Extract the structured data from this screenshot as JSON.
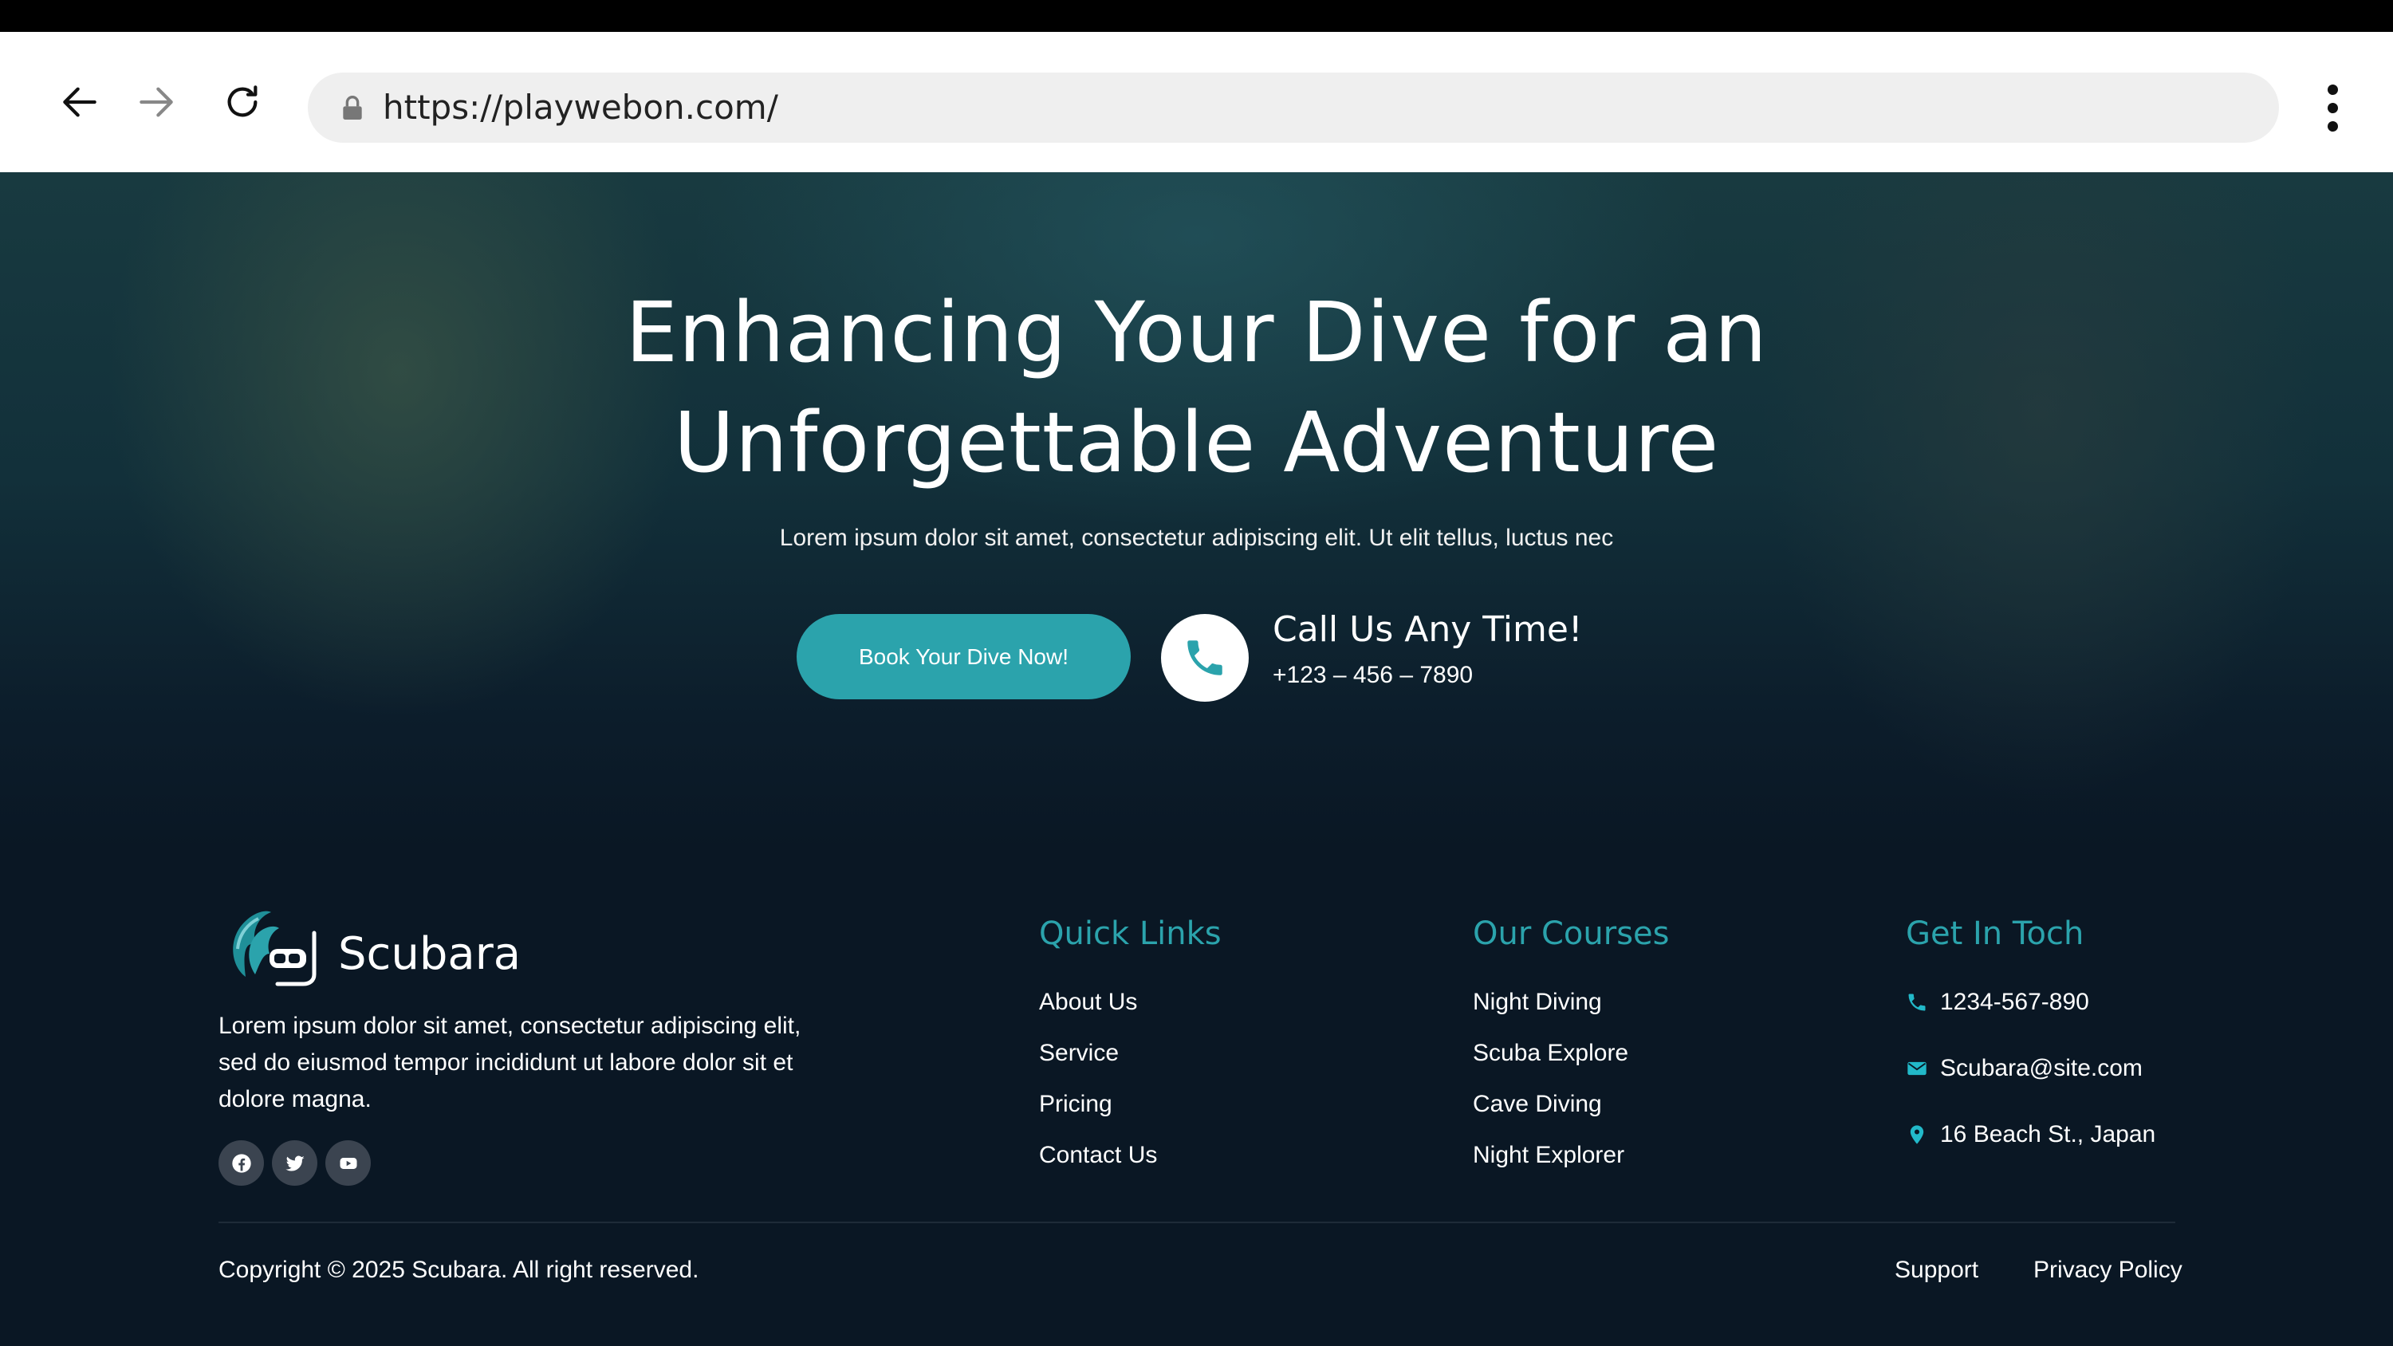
{
  "browser": {
    "url": "https://playwebon.com/"
  },
  "hero": {
    "title_line1": "Enhancing Your Dive for an",
    "title_line2": "Unforgettable Adventure",
    "subtitle": "Lorem ipsum dolor sit amet, consectetur adipiscing elit. Ut elit tellus, luctus nec",
    "book_button": "Book Your Dive Now!",
    "call_title": "Call Us Any Time!",
    "call_number": "+123 – 456 – 7890"
  },
  "footer": {
    "brand": "Scubara",
    "about_line1": "Lorem ipsum dolor sit amet, consectetur adipiscing elit,",
    "about_line2": "sed do eiusmod tempor incididunt ut labore dolor sit et",
    "about_line3": "dolore magna.",
    "quick_links": {
      "title": "Quick Links",
      "items": [
        "About Us",
        "Service",
        "Pricing",
        "Contact Us"
      ]
    },
    "courses": {
      "title": "Our Courses",
      "items": [
        "Night Diving",
        "Scuba Explore",
        "Cave Diving",
        "Night Explorer"
      ]
    },
    "contact": {
      "title": "Get In Toch",
      "phone": "1234-567-890",
      "email": "Scubara@site.com",
      "address": "16 Beach St., Japan"
    },
    "copyright": "Copyright © 2025 Scubara. All right reserved.",
    "support": "Support",
    "privacy": "Privacy Policy"
  },
  "colors": {
    "accent": "#2ba3ac",
    "background": "#0a1724"
  },
  "icons": [
    "back-arrow-icon",
    "forward-arrow-icon",
    "reload-icon",
    "lock-icon",
    "kebab-menu-icon",
    "phone-icon",
    "facebook-icon",
    "twitter-icon",
    "youtube-icon",
    "email-icon",
    "location-pin-icon"
  ]
}
